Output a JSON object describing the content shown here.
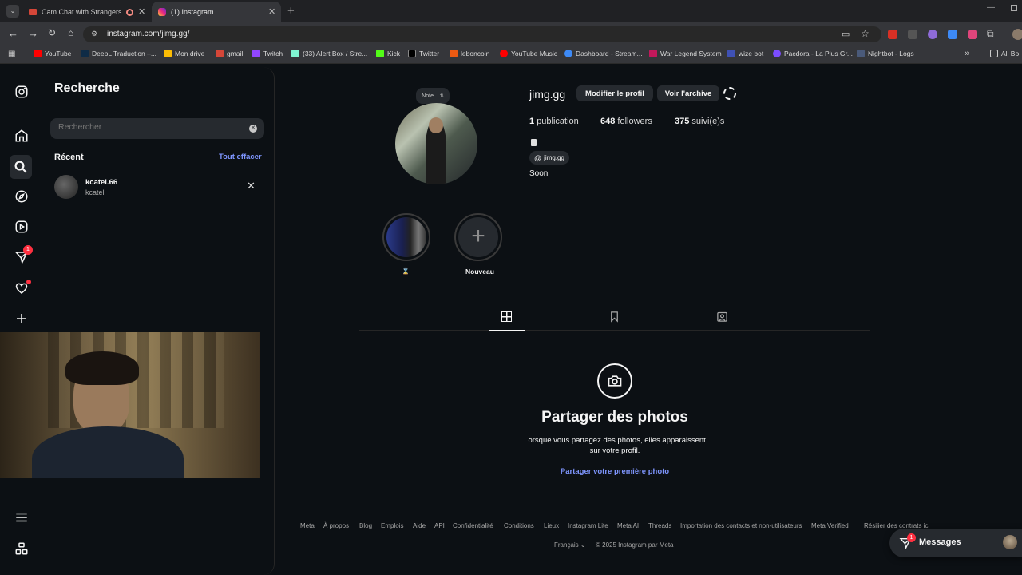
{
  "browser": {
    "tabs": [
      {
        "title": "Cam Chat with Strangers on"
      },
      {
        "title": "(1) Instagram"
      }
    ],
    "url": "instagram.com/jimg.gg/",
    "bookmarks": [
      "YouTube",
      "DeepL Traduction –...",
      "Mon drive",
      "gmail",
      "Twitch",
      "(33) Alert Box / Stre...",
      "Kick",
      "Twitter",
      "leboncoin",
      "YouTube Music",
      "Dashboard - Stream...",
      "War Legend System",
      "wize bot",
      "Pacdora - La Plus Gr...",
      "Nightbot - Logs"
    ],
    "all_bookmarks": "All Bo",
    "more_bookmarks": "»"
  },
  "nav": {
    "notif_badge": "1"
  },
  "search": {
    "title": "Recherche",
    "placeholder": "Rechercher",
    "recent_label": "Récent",
    "clear_all": "Tout effacer",
    "recent": [
      {
        "username": "kcatel.66",
        "name": "kcatel"
      }
    ]
  },
  "profile": {
    "note": "Note...",
    "username": "jimg.gg",
    "edit_button": "Modifier le profil",
    "archive_button": "Voir l'archive",
    "stats": [
      {
        "count": "1",
        "label": "publication"
      },
      {
        "count": "648",
        "label": "followers"
      },
      {
        "count": "375",
        "label": "suivi(e)s"
      }
    ],
    "threads_handle": "jimg.gg",
    "bio": "Soon",
    "highlights": [
      {
        "label": "⌛"
      },
      {
        "label": "Nouveau"
      }
    ]
  },
  "empty": {
    "title": "Partager des photos",
    "line1": "Lorsque vous partagez des photos, elles apparaissent",
    "line2": "sur votre profil.",
    "cta": "Partager votre première photo"
  },
  "footer": {
    "links": [
      "Meta",
      "À propos",
      "Blog",
      "Emplois",
      "Aide",
      "API",
      "Confidentialité",
      "Conditions",
      "Lieux",
      "Instagram Lite",
      "Meta AI",
      "Threads",
      "Importation des contacts et non-utilisateurs",
      "Meta Verified",
      "Résilier des contrats ici"
    ],
    "language": "Français",
    "copyright": "© 2025 Instagram par Meta"
  },
  "messages": {
    "label": "Messages",
    "badge": "1"
  },
  "colors": {
    "bg": "#0c1014",
    "accent": "#7f96ff",
    "badge": "#ff3040",
    "chrome": "#35363a"
  }
}
